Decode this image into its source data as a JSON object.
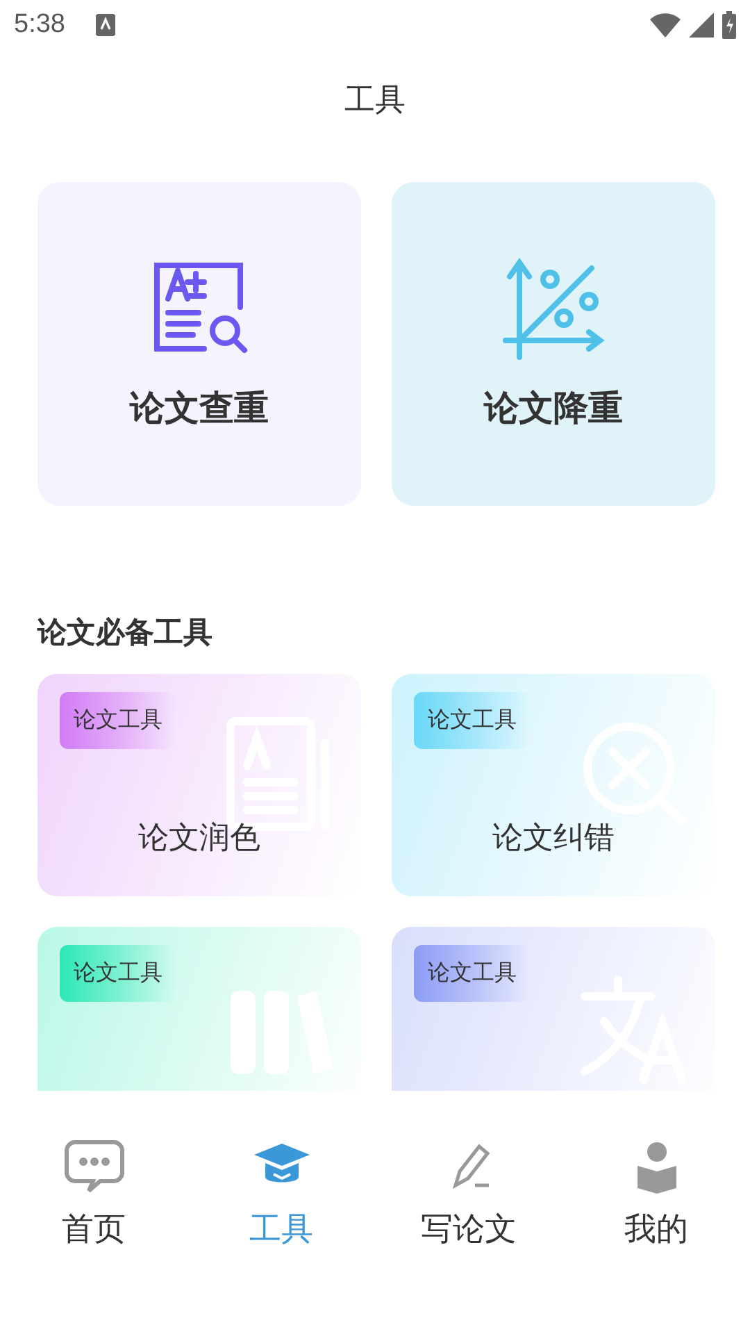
{
  "status_bar": {
    "time": "5:38"
  },
  "header": {
    "title": "工具"
  },
  "main_tools": [
    {
      "kind": "check",
      "label": "论文查重"
    },
    {
      "kind": "reduce",
      "label": "论文降重"
    }
  ],
  "section": {
    "title": "论文必备工具"
  },
  "tools": [
    {
      "kind": "document",
      "tag": "论文工具",
      "name": "论文润色",
      "color": "#d07cf5"
    },
    {
      "kind": "error-search",
      "tag": "论文工具",
      "name": "论文纠错",
      "color": "#6ad8f8"
    },
    {
      "kind": "books",
      "tag": "论文工具",
      "color": "#2de8b6"
    },
    {
      "kind": "translate",
      "tag": "论文工具",
      "color": "#8c9cf5"
    }
  ],
  "tabs": [
    {
      "kind": "chat",
      "label": "首页",
      "selected": false
    },
    {
      "kind": "cap",
      "label": "工具",
      "selected": true
    },
    {
      "kind": "pen",
      "label": "写论文",
      "selected": false
    },
    {
      "kind": "reader",
      "label": "我的",
      "selected": false
    }
  ]
}
